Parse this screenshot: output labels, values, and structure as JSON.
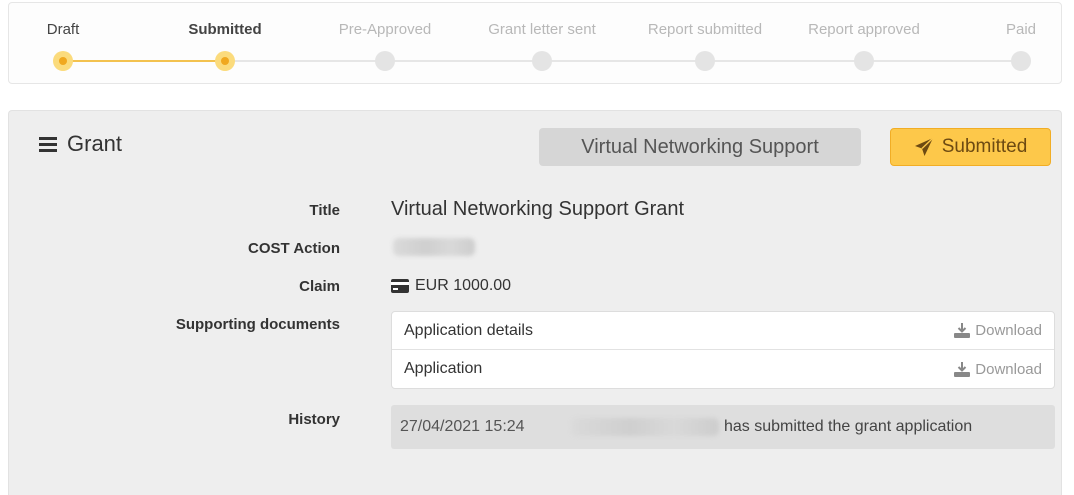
{
  "stepper": {
    "steps": [
      {
        "label": "Draft",
        "state": "done"
      },
      {
        "label": "Submitted",
        "state": "current"
      },
      {
        "label": "Pre-Approved",
        "state": "pending"
      },
      {
        "label": "Grant letter sent",
        "state": "pending"
      },
      {
        "label": "Report submitted",
        "state": "pending"
      },
      {
        "label": "Report approved",
        "state": "pending"
      },
      {
        "label": "Paid",
        "state": "pending"
      }
    ],
    "active_color": "#f0a81f",
    "inactive_color": "#e4e4e4"
  },
  "grant": {
    "header_title": "Grant",
    "menu_icon": "hamburger-icon",
    "type_badge": "Virtual Networking Support",
    "status_badge": {
      "label": "Submitted",
      "icon": "paper-plane-icon",
      "color": "#fdc84a"
    },
    "fields": {
      "title_label": "Title",
      "title_value": "Virtual Networking Support Grant",
      "cost_action_label": "COST Action",
      "claim_label": "Claim",
      "claim_icon": "credit-card-icon",
      "claim_value": "EUR 1000.00",
      "supporting_docs_label": "Supporting documents",
      "history_label": "History"
    },
    "documents": [
      {
        "name": "Application details",
        "action": "Download",
        "icon": "download-icon"
      },
      {
        "name": "Application",
        "action": "Download",
        "icon": "download-icon"
      }
    ],
    "history": [
      {
        "timestamp": "27/04/2021 15:24",
        "message": "has submitted the grant application"
      }
    ]
  }
}
